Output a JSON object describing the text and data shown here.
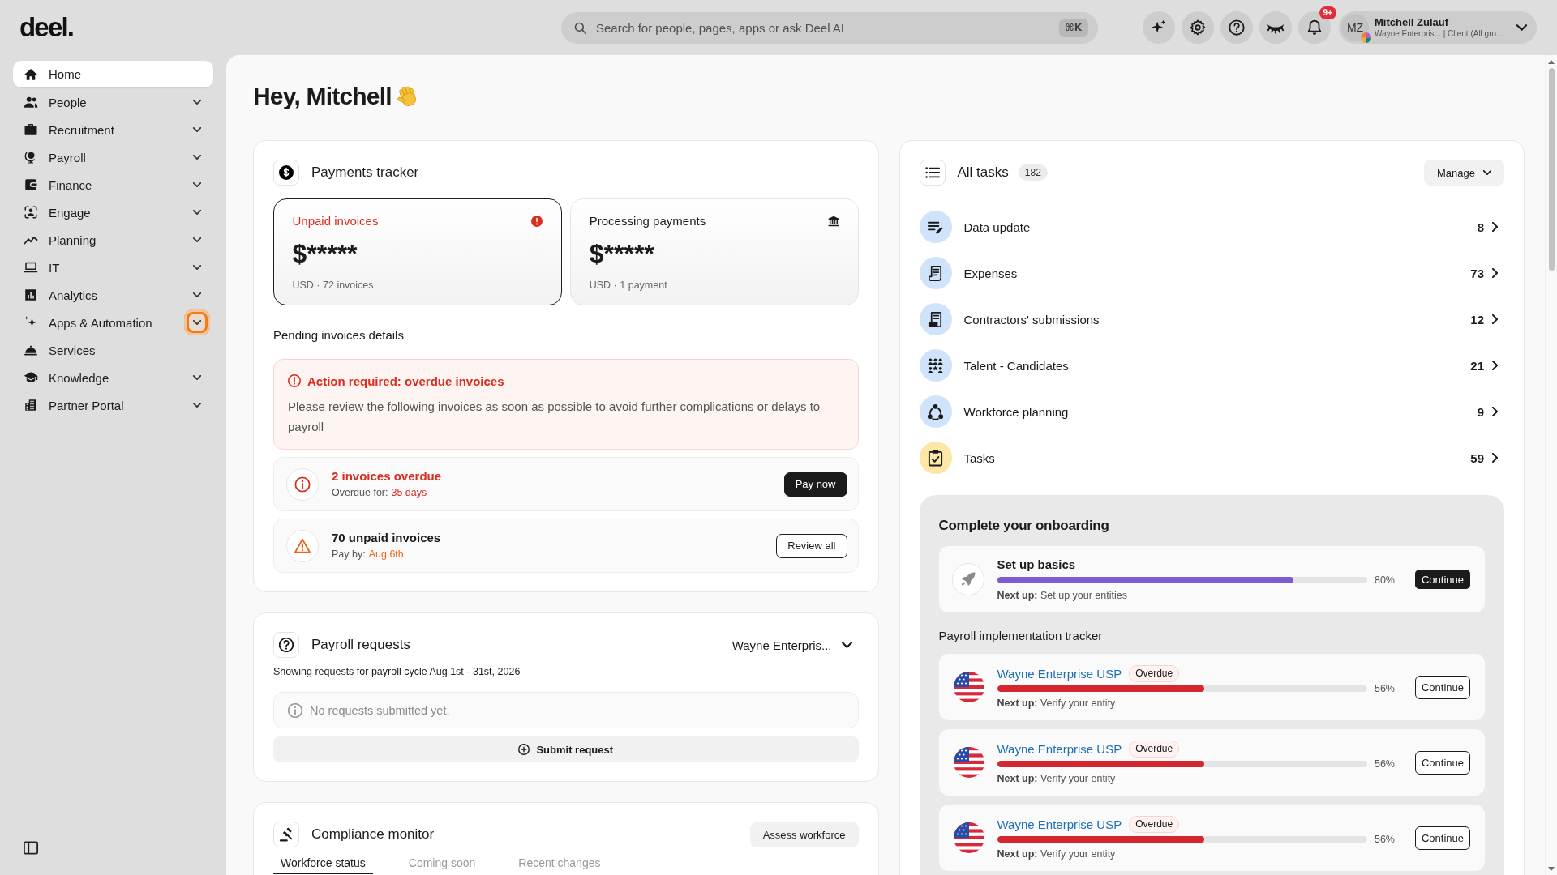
{
  "top_bar": {
    "logo": "deel.",
    "search": {
      "placeholder": "Search for people, pages, apps or ask Deel AI",
      "shortcut": "⌘K"
    },
    "actions": [
      {
        "kind": "ai"
      },
      {
        "kind": "settings"
      },
      {
        "kind": "help"
      },
      {
        "kind": "privacy"
      },
      {
        "kind": "notifications",
        "badge": "9+"
      }
    ],
    "user": {
      "initials": "MZ",
      "name": "Mitchell Zulauf",
      "subtitle": "Wayne Enterpris... | Client (All gro..."
    }
  },
  "sidebar": {
    "items": [
      {
        "kind": "home",
        "label": "Home",
        "selected": true,
        "expandable": false,
        "focused": false
      },
      {
        "kind": "people",
        "label": "People",
        "selected": false,
        "expandable": true,
        "focused": false
      },
      {
        "kind": "recruitment",
        "label": "Recruitment",
        "selected": false,
        "expandable": true,
        "focused": false
      },
      {
        "kind": "payroll",
        "label": "Payroll",
        "selected": false,
        "expandable": true,
        "focused": false
      },
      {
        "kind": "finance",
        "label": "Finance",
        "selected": false,
        "expandable": true,
        "focused": false
      },
      {
        "kind": "engage",
        "label": "Engage",
        "selected": false,
        "expandable": true,
        "focused": false
      },
      {
        "kind": "planning",
        "label": "Planning",
        "selected": false,
        "expandable": true,
        "focused": false
      },
      {
        "kind": "it",
        "label": "IT",
        "selected": false,
        "expandable": true,
        "focused": false
      },
      {
        "kind": "analytics",
        "label": "Analytics",
        "selected": false,
        "expandable": true,
        "focused": false
      },
      {
        "kind": "apps",
        "label": "Apps & Automation",
        "selected": false,
        "expandable": true,
        "focused": true
      },
      {
        "kind": "services",
        "label": "Services",
        "selected": false,
        "expandable": false,
        "focused": false
      },
      {
        "kind": "knowledge",
        "label": "Knowledge",
        "selected": false,
        "expandable": true,
        "focused": false
      },
      {
        "kind": "partner",
        "label": "Partner Portal",
        "selected": false,
        "expandable": true,
        "focused": false
      }
    ]
  },
  "greeting": "Hey, Mitchell",
  "payments_tracker": {
    "title": "Payments tracker",
    "summaries": [
      {
        "kind": "alert",
        "title": "Unpaid invoices",
        "amount": "$*****",
        "detail": "USD · 72 invoices",
        "selected": true
      },
      {
        "kind": "bank",
        "title": "Processing payments",
        "amount": "$*****",
        "detail": "USD · 1 payment",
        "selected": false
      }
    ],
    "details_title": "Pending invoices details",
    "alert": {
      "title": "Action required: overdue invoices",
      "message": "Please review the following invoices as soon as possible to avoid further complications or delays to payroll"
    },
    "items": [
      {
        "kind": "overdue",
        "title": "2 invoices overdue",
        "due_label": "Overdue for:",
        "due_value": "35 days",
        "button": "Pay now"
      },
      {
        "kind": "unpaid",
        "title": "70 unpaid invoices",
        "due_label": "Pay by:",
        "due_value": "Aug 6th",
        "button": "Review all"
      }
    ]
  },
  "payroll_requests": {
    "title": "Payroll requests",
    "entity": "Wayne Enterpris...",
    "caption": "Showing requests for payroll cycle Aug 1st - 31st, 2026",
    "empty_message": "No requests submitted yet.",
    "button": "Submit request"
  },
  "compliance_monitor": {
    "title": "Compliance monitor",
    "button": "Assess workforce",
    "tabs": [
      {
        "label": "Workforce status",
        "selected": true
      },
      {
        "label": "Coming soon",
        "selected": false
      },
      {
        "label": "Recent changes",
        "selected": false
      }
    ]
  },
  "all_tasks": {
    "title": "All tasks",
    "count": "182",
    "button": "Manage",
    "items": [
      {
        "kind": "data_update",
        "label": "Data update",
        "count": "8",
        "color": "#cfe4fb"
      },
      {
        "kind": "expenses",
        "label": "Expenses",
        "count": "73",
        "color": "#cfe4fb"
      },
      {
        "kind": "contractors",
        "label": "Contractors' submissions",
        "count": "12",
        "color": "#cfe4fb"
      },
      {
        "kind": "talent",
        "label": "Talent - Candidates",
        "count": "21",
        "color": "#cfe4fb"
      },
      {
        "kind": "workforce",
        "label": "Workforce planning",
        "count": "9",
        "color": "#cfe4fb"
      },
      {
        "kind": "tasks",
        "label": "Tasks",
        "count": "59",
        "color": "#fce7a6"
      }
    ],
    "onboarding": {
      "title": "Complete your onboarding",
      "basics": {
        "title": "Set up basics",
        "level": 0.8,
        "percent": "80%",
        "next": "**Next up:** Set up your entities",
        "button": "Continue"
      },
      "tracker_title": "Payroll implementation tracker",
      "entities": [
        {
          "kind": "overdue",
          "name": "Wayne Enterprise USP",
          "status": "Overdue",
          "level": 0.56,
          "percent": "56%",
          "next": "**Next up:** Verify your entity",
          "button": "Continue"
        },
        {
          "kind": "overdue",
          "name": "Wayne Enterprise USP",
          "status": "Overdue",
          "level": 0.56,
          "percent": "56%",
          "next": "**Next up:** Verify your entity",
          "button": "Continue"
        },
        {
          "kind": "overdue",
          "name": "Wayne Enterprise USP",
          "status": "Overdue",
          "level": 0.56,
          "percent": "56%",
          "next": "**Next up:** Verify your entity",
          "button": "Continue"
        }
      ]
    }
  }
}
